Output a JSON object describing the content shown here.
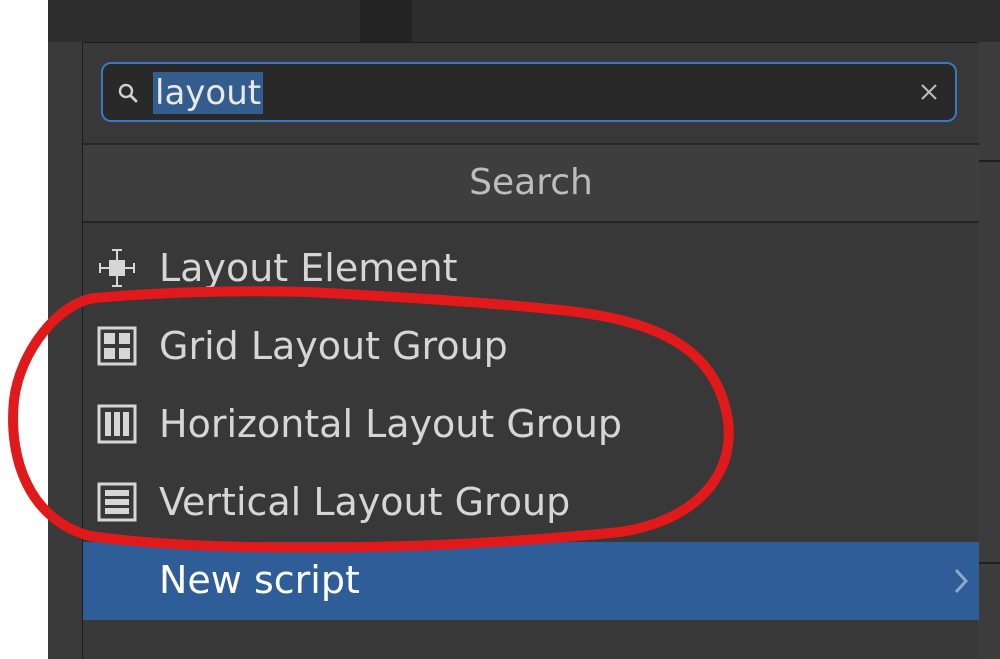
{
  "search": {
    "value": "layout",
    "selected_text": "layout"
  },
  "header": {
    "title": "Search"
  },
  "results": [
    {
      "label": "Layout Element",
      "icon": "layout-element-icon"
    },
    {
      "label": "Grid Layout Group",
      "icon": "grid-layout-icon"
    },
    {
      "label": "Horizontal Layout Group",
      "icon": "horizontal-layout-icon"
    },
    {
      "label": "Vertical Layout Group",
      "icon": "vertical-layout-icon"
    },
    {
      "label": "New script",
      "icon": "chevron-right-icon",
      "selected": true
    }
  ],
  "colors": {
    "selection": "#2f5d98",
    "search_focus": "#3a79bf",
    "annotation": "#e0191b"
  }
}
